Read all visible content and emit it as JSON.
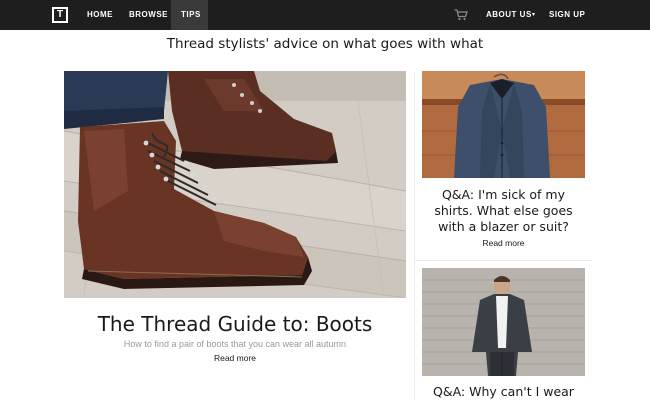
{
  "nav": {
    "logo_letter": "T",
    "links": {
      "home": "HOME",
      "browse": "BROWSE",
      "tips": "TIPS",
      "about": "ABOUT US",
      "signup": "SIGN UP"
    },
    "chevron": "▾"
  },
  "headline": "Thread stylists' advice on what goes with what",
  "feature": {
    "title": "The Thread Guide to: Boots",
    "subtitle": "How to find a pair of boots that you can wear all autumn",
    "read_more": "Read more"
  },
  "cards": [
    {
      "title": "Q&A: I'm sick of my shirts. What else goes with a blazer or suit?",
      "read_more": "Read more"
    },
    {
      "title": "Q&A: Why can't I wear"
    }
  ],
  "colors": {
    "nav_bg": "#1e1e1e",
    "nav_active": "#3a3a3a",
    "text": "#1a1a1a",
    "muted": "#9a9a9a"
  }
}
